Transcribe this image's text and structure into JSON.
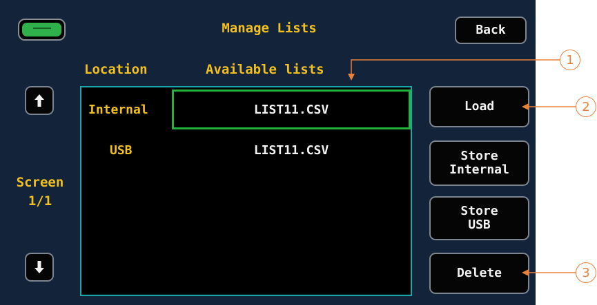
{
  "header": {
    "title": "Manage Lists",
    "back_label": "Back"
  },
  "columns": {
    "location": "Location",
    "available": "Available lists"
  },
  "rows": [
    {
      "location": "Internal",
      "file": "LIST11.CSV",
      "selected": true
    },
    {
      "location": "USB",
      "file": "LIST11.CSV",
      "selected": false
    }
  ],
  "side": {
    "screen_label": "Screen",
    "page": "1/1",
    "up_icon": "arrow-up-icon",
    "down_icon": "arrow-down-icon"
  },
  "actions": {
    "load": "Load",
    "store_internal": "Store\nInternal",
    "store_usb": "Store\nUSB",
    "delete": "Delete"
  },
  "callouts": [
    "1",
    "2",
    "3"
  ],
  "colors": {
    "background": "#13243a",
    "text_accent": "#f2c01f",
    "list_border": "#1aa7a9",
    "selection": "#23b23a",
    "callout": "#e8823a",
    "status_led": "#2fb04a"
  }
}
